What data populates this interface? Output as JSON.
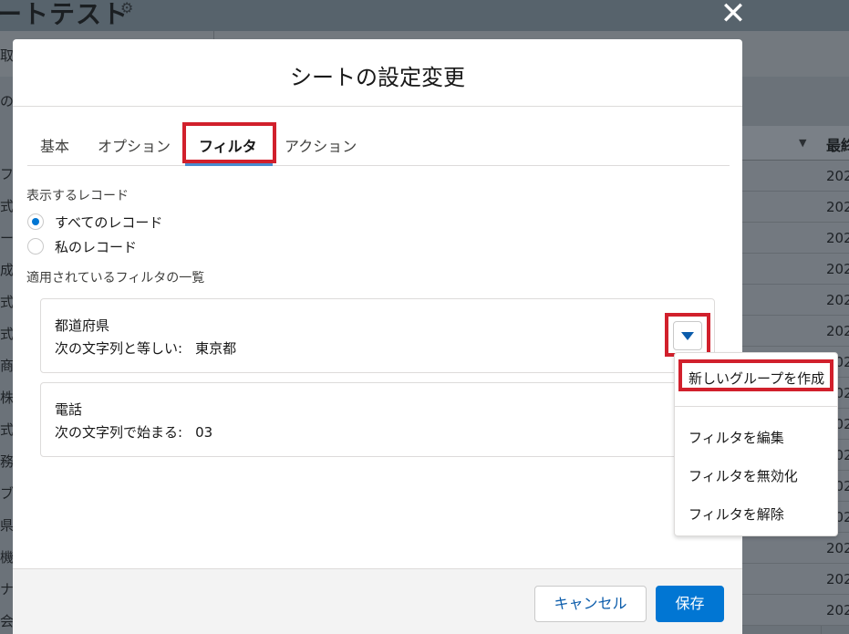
{
  "background": {
    "page_title": "ートテスト",
    "column_header": "最終",
    "row_dates": [
      "202",
      "202",
      "202",
      "202",
      "202",
      "202",
      "202",
      "202",
      "202",
      "202",
      "202",
      "202",
      "202",
      "202",
      "202"
    ],
    "side_texts": [
      "取引",
      "のへ",
      "フ",
      "式会",
      "ー",
      "成ネ",
      "式会",
      "式会",
      "商会",
      "株",
      "式会",
      "務所",
      "ブ株",
      "県",
      "機械",
      "ナー",
      "会社"
    ]
  },
  "modal": {
    "title": "シートの設定変更",
    "tabs": [
      {
        "label": "基本",
        "active": false
      },
      {
        "label": "オプション",
        "active": false
      },
      {
        "label": "フィルタ",
        "active": true
      },
      {
        "label": "アクション",
        "active": false
      }
    ],
    "records_section": {
      "label": "表示するレコード",
      "options": [
        {
          "label": "すべてのレコード",
          "checked": true
        },
        {
          "label": "私のレコード",
          "checked": false
        }
      ]
    },
    "filters_section": {
      "label": "適用されているフィルタの一覧",
      "filters": [
        {
          "field": "都道府県",
          "operator": "次の文字列と等しい:",
          "value": "東京都"
        },
        {
          "field": "電話",
          "operator": "次の文字列で始まる:",
          "value": "03"
        }
      ]
    },
    "footer": {
      "cancel_label": "キャンセル",
      "save_label": "保存"
    }
  },
  "dropdown_menu": {
    "items": [
      "新しいグループを作成",
      "フィルタを編集",
      "フィルタを無効化",
      "フィルタを解除"
    ]
  },
  "colors": {
    "brand_blue": "#0176d3",
    "highlight_red": "#d1202c",
    "tab_underline": "#4a8ccf"
  },
  "icons": {
    "close": "close-icon",
    "dropdown": "chevron-down-icon",
    "settings": "gear-icon"
  }
}
